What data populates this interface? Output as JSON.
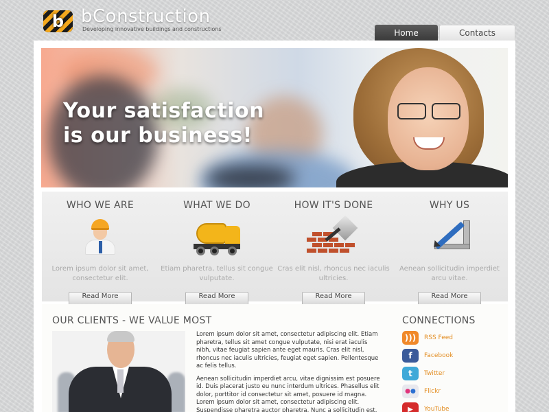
{
  "header": {
    "logo_letter": "b",
    "brand": "bConstruction",
    "tagline": "Developing innovative buildings and constructions",
    "nav": [
      {
        "label": "Home"
      },
      {
        "label": "Contacts"
      }
    ]
  },
  "hero": {
    "title": "Your satisfaction\nis our business!"
  },
  "features": [
    {
      "title": "WHO WE ARE",
      "icon": "worker-icon",
      "text": "Lorem ipsum dolor sit amet, consectetur elit.",
      "button": "Read More"
    },
    {
      "title": "WHAT WE DO",
      "icon": "truck-icon",
      "text": "Etiam pharetra, tellus sit  congue vulputate.",
      "button": "Read More"
    },
    {
      "title": "HOW IT'S DONE",
      "icon": "brick-wall-icon",
      "text": "Cras elit nisl, rhoncus nec iaculis ultricies.",
      "button": "Read More"
    },
    {
      "title": "WHY US",
      "icon": "ruler-pencil-icon",
      "text": "Aenean sollicitudin imperdiet arcu vitae.",
      "button": "Read More"
    }
  ],
  "clients": {
    "title": "OUR CLIENTS - WE VALUE MOST",
    "paragraph1": "Lorem ipsum dolor sit amet, consectetur adipiscing elit. Etiam pharetra, tellus sit amet congue vulputate, nisi erat iaculis nibh, vitae feugiat sapien ante eget mauris. Cras elit nisl, rhoncus nec iaculis ultricies, feugiat eget sapien. Pellentesque ac felis tellus.",
    "paragraph2": "Aenean sollicitudin imperdiet arcu, vitae dignissim est posuere id. Duis placerat justo eu nunc interdum ultrices. Phasellus elit dolor, porttitor id consectetur sit amet, posuere id magna. Lorem ipsum dolor sit amet, consectetur adipiscing elit. Suspendisse pharetra auctor pharetra. Nunc a sollicitudin est."
  },
  "connections": {
    "title": "CONNECTIONS",
    "items": [
      {
        "label": "RSS Feed",
        "icon": "rss-icon",
        "color": "#f0892a",
        "glyph": ")))"
      },
      {
        "label": "Facebook",
        "icon": "facebook-icon",
        "color": "#3b5b9a",
        "glyph": "f"
      },
      {
        "label": "Twitter",
        "icon": "twitter-icon",
        "color": "#3fa9d8",
        "glyph": "t"
      },
      {
        "label": "Flickr",
        "icon": "flickr-icon",
        "color": "#e8e8ee",
        "glyph": "●●"
      },
      {
        "label": "YouTube",
        "icon": "youtube-icon",
        "color": "#d52b2b",
        "glyph": "▶"
      }
    ]
  },
  "colors": {
    "accent_orange": "#e28b1e",
    "nav_active": "#3a3a3a"
  }
}
